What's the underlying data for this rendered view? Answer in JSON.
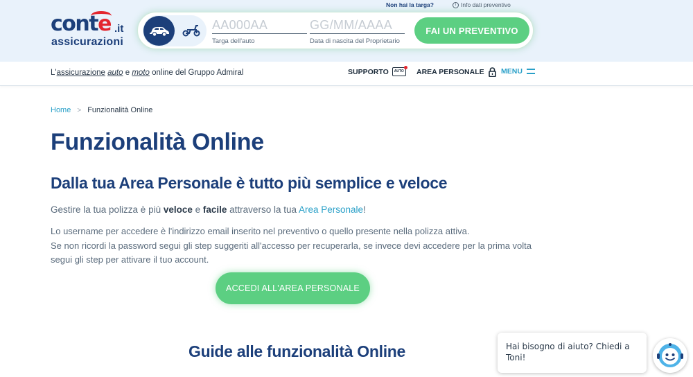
{
  "brand": {
    "logo_main_prefix": "cont",
    "logo_main_e": "e",
    "logo_tld": ".it",
    "logo_sub": "assicurazioni"
  },
  "quote_form": {
    "plate_placeholder": "AA000AA",
    "plate_label": "Targa dell'auto",
    "birthdate_placeholder": "GG/MM/AAAA",
    "birthdate_label": "Data di nascita del Proprietario",
    "cta_label": "FAI UN PREVENTIVO",
    "no_plate_link": "Non hai la targa?",
    "info_link": "Info dati preventivo"
  },
  "nav": {
    "tagline_1": "L'",
    "tagline_2": "assicurazione",
    "tagline_3": "auto",
    "tagline_4": " e ",
    "tagline_5": "moto",
    "tagline_6": " online del Gruppo Admiral",
    "support_label": "SUPPORTO",
    "support_icon_text": "AUTO",
    "area_label": "AREA PERSONALE",
    "menu_label": "MENU"
  },
  "breadcrumb": {
    "home": "Home",
    "separator": ">",
    "current": "Funzionalità Online"
  },
  "content": {
    "title": "Funzionalità Online",
    "subtitle": "Dalla tua Area Personale è tutto più semplice e veloce",
    "p1_a": "Gestire la tua polizza è più ",
    "p1_b": "veloce",
    "p1_c": " e ",
    "p1_d": "facile",
    "p1_e": " attraverso la tua ",
    "p1_link": "Area Personale",
    "p1_f": "!",
    "p2_line1": "Lo username per accedere è l'indirizzo email inserito nel preventivo o quello presente nella polizza attiva.",
    "p2_line2": "Se non ricordi la password segui gli step suggeriti all'accesso per recuperarla, se invece devi accedere per la prima volta segui gli step per attivare il tuo account.",
    "cta_area": "ACCEDI ALL'AREA PERSONALE",
    "guide_title": "Guide alle funzionalità Online"
  },
  "chat": {
    "message": "Hai bisogno di aiuto? Chiedi a Toni!"
  },
  "colors": {
    "brand_navy": "#1c3f7a",
    "brand_red": "#e3262e",
    "cta_green": "#5ccf82",
    "link_blue": "#2aa0c8",
    "header_bg": "#e9f2fb"
  }
}
